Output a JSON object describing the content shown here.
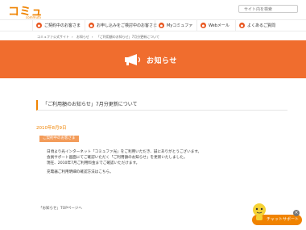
{
  "header": {
    "logo_main": "コミュファ",
    "logo_sub": "commufa",
    "search_placeholder": "サイト内を検索"
  },
  "nav": {
    "items": [
      {
        "label": "ご契約中のお客さま",
        "icon": "person-icon"
      },
      {
        "label": "お申し込みをご検討中のお客さま",
        "icon": "house-icon"
      },
      {
        "label": "Myコミュファ",
        "icon": "my-icon"
      },
      {
        "label": "Webメール",
        "icon": "mail-icon"
      },
      {
        "label": "よくあるご質問",
        "icon": "question-icon"
      }
    ]
  },
  "breadcrumb": {
    "items": [
      "コミュファ公式サイト",
      "お知らせ",
      "「ご利用額のお知らせ」7月分更新について"
    ]
  },
  "banner": {
    "title": "お知らせ",
    "icon": "megaphone-icon"
  },
  "article": {
    "title": "「ご利用額のお知らせ」7月分更新について",
    "date": "2010年8月9日",
    "tag": "ご契約中のお客さま",
    "body": [
      "日頃より光インターネット「コミュファ光」をご利用いただき、誠にありがとうございます。",
      "会員サポート画面にてご確認いただく「ご利用額のお知らせ」を更新いたしました。",
      "現在、2010年7月ご利用料金までご確認いただけます。",
      "",
      "充電器ご利用明細の確認方法はこちら。"
    ]
  },
  "footer": {
    "back_link": "「お知らせ」TOPページへ"
  },
  "chat": {
    "label": "チャットサポート",
    "close": "×"
  }
}
